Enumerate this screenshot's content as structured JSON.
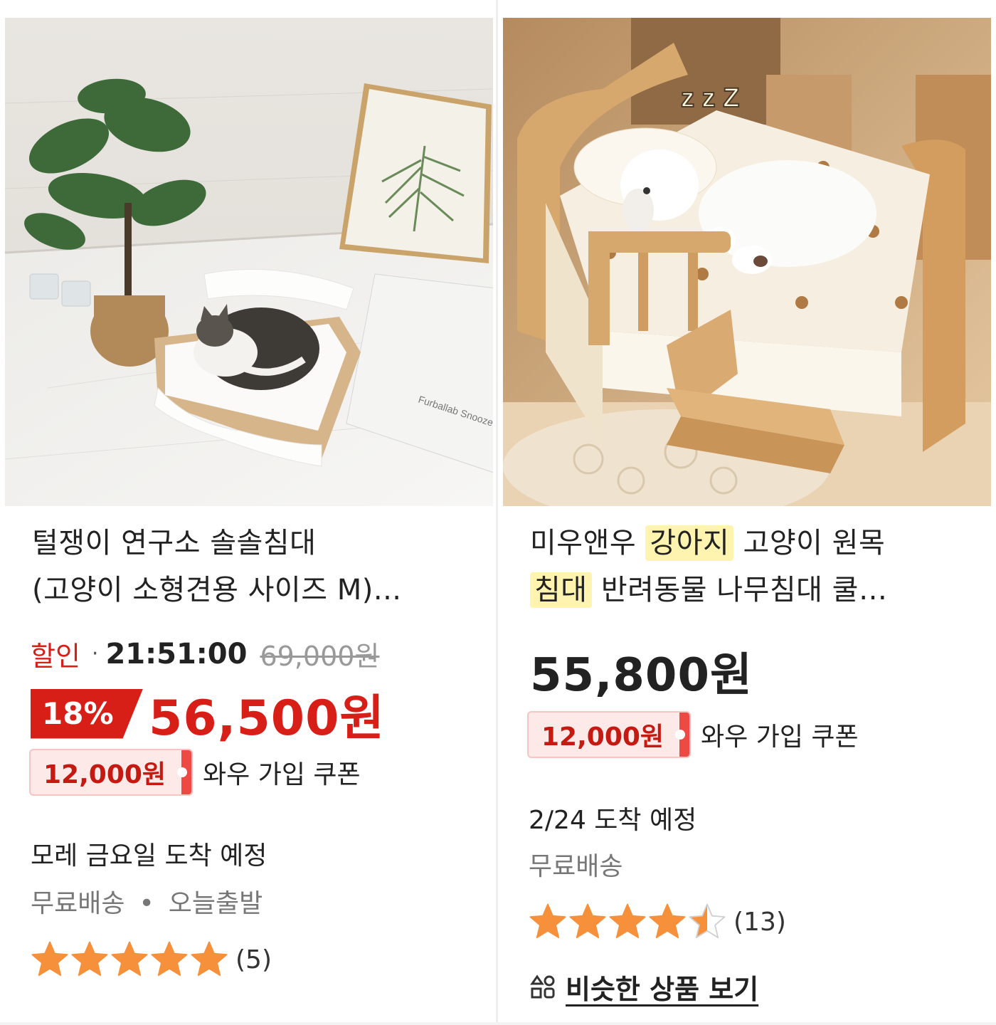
{
  "products": [
    {
      "title_line1": "털쟁이 연구소 솔솔침대",
      "title_line2": "(고양이 소형견용 사이즈 M)...",
      "sale_label": "할인",
      "timer": "21:51:00",
      "original_price": "69,000원",
      "discount_pct": "18%",
      "sale_price": "56,500원",
      "coupon_amount": "12,000원",
      "coupon_text": "와우 가입 쿠폰",
      "delivery": "모레 금요일 도착 예정",
      "shipping": "무료배송",
      "shipping_extra": "오늘출발",
      "rating": 5,
      "rating_count": "(5)",
      "image_text": "Furballab Snooze Solid Wood Furniture"
    },
    {
      "title_seg1": "미우앤우",
      "title_hl1": "강아지",
      "title_seg2": "고양이 원목",
      "title_hl2": "침대",
      "title_seg3": "반려동물 나무침대 쿨…",
      "price": "55,800원",
      "coupon_amount": "12,000원",
      "coupon_text": "와우 가입 쿠폰",
      "delivery": "2/24 도착 예정",
      "shipping": "무료배송",
      "rating": 4.5,
      "rating_count": "(13)",
      "similar_label": "비슷한 상품 보기",
      "image_text": "z z Z"
    }
  ],
  "colors": {
    "discount_red": "#d81f17",
    "coupon_bg": "#fde9e8",
    "star": "#f7903a",
    "highlight": "#fff3b0"
  },
  "icons": [
    "star-icon",
    "similar-products-icon"
  ]
}
